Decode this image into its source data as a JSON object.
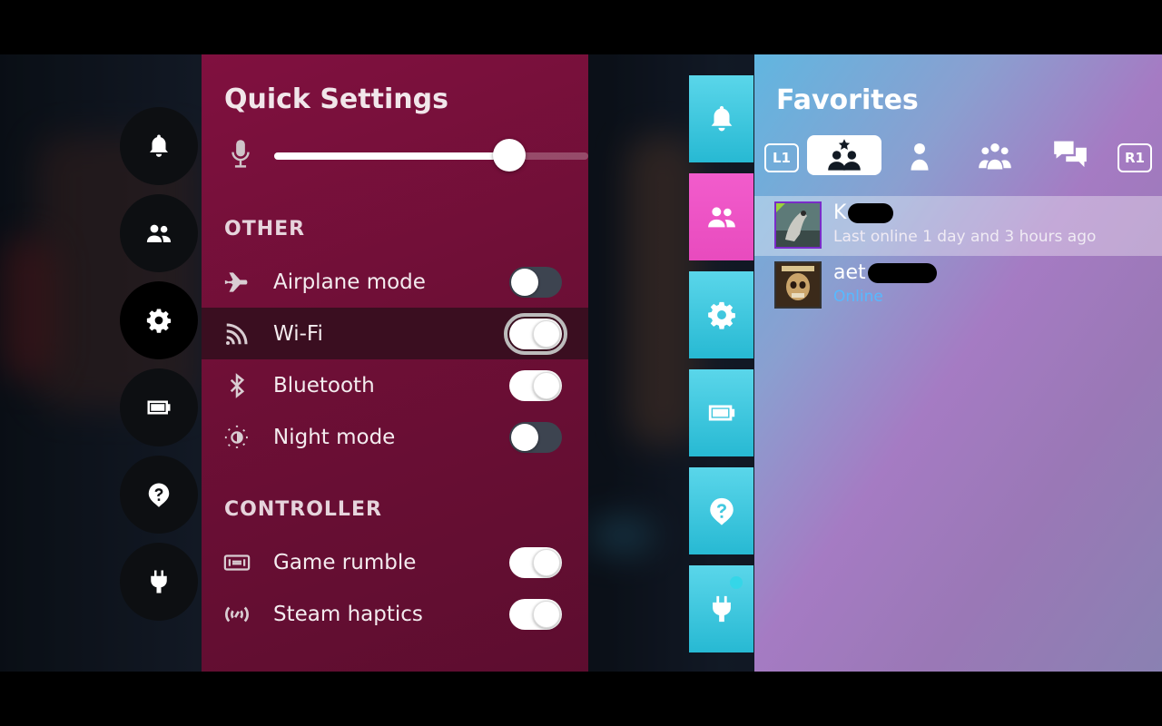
{
  "quick_settings": {
    "title": "Quick Settings",
    "mic_volume_fraction": 0.75,
    "section_other": "OTHER",
    "section_controller": "CONTROLLER",
    "toggles": [
      {
        "label": "Airplane mode",
        "icon": "airplane-icon",
        "state": "off"
      },
      {
        "label": "Wi-Fi",
        "icon": "wifi-icon",
        "state": "on",
        "focused": true
      },
      {
        "label": "Bluetooth",
        "icon": "bluetooth-icon",
        "state": "on"
      },
      {
        "label": "Night mode",
        "icon": "night-mode-icon",
        "state": "off"
      },
      {
        "label": "Game rumble",
        "icon": "rumble-icon",
        "state": "on"
      },
      {
        "label": "Steam haptics",
        "icon": "haptics-icon",
        "state": "on"
      }
    ]
  },
  "left_nav": {
    "items": [
      "notifications-icon",
      "friends-icon",
      "settings-icon",
      "battery-icon",
      "help-icon",
      "power-plug-icon"
    ],
    "active": "settings-icon"
  },
  "right_tabs": {
    "items": [
      "notifications-icon",
      "friends-icon",
      "settings-icon",
      "battery-icon",
      "help-icon",
      "power-plug-icon"
    ],
    "active": "friends-icon",
    "accent_cyan": "#27b9d3",
    "accent_pink": "#e84bbe"
  },
  "favorites": {
    "title": "Favorites",
    "left_shoulder": "L1",
    "right_shoulder": "R1",
    "tabs": [
      "favorites-icon",
      "person-icon",
      "group-icon",
      "chat-icon"
    ],
    "active_tab": "favorites-icon",
    "friends": [
      {
        "name": "K",
        "status": "Last online 1 day and 3 hours ago",
        "online": false
      },
      {
        "name": "aet",
        "status": "Online",
        "online": true
      }
    ]
  }
}
